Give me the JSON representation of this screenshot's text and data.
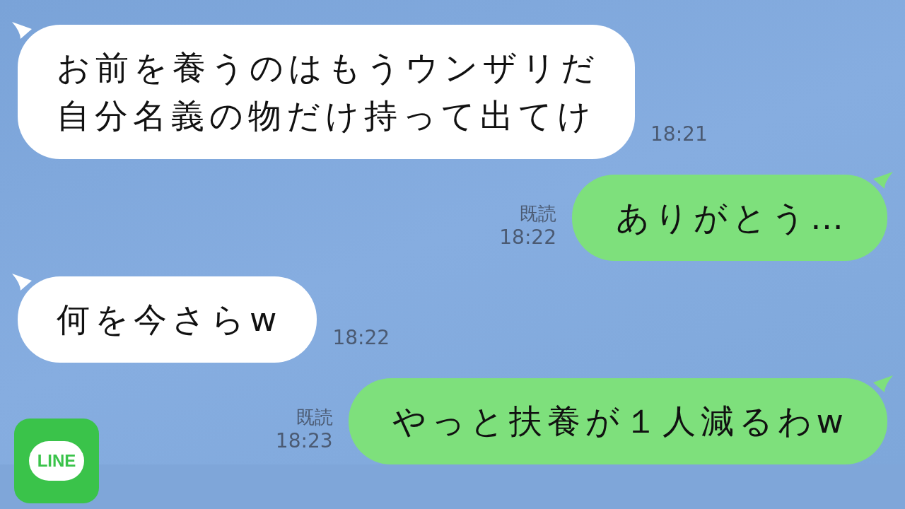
{
  "messages": [
    {
      "kind": "incoming",
      "lines": [
        "お前を養うのはもうウンザリだ",
        "自分名義の物だけ持って出てけ"
      ],
      "time": "18:21"
    },
    {
      "kind": "outgoing",
      "lines": [
        "ありがとう…"
      ],
      "read_label": "既読",
      "time": "18:22"
    },
    {
      "kind": "incoming",
      "lines": [
        "何を今さらw"
      ],
      "time": "18:22"
    },
    {
      "kind": "outgoing",
      "lines": [
        "やっと扶養が１人減るわw"
      ],
      "read_label": "既読",
      "time": "18:23"
    }
  ],
  "logo": {
    "text": "LINE"
  }
}
